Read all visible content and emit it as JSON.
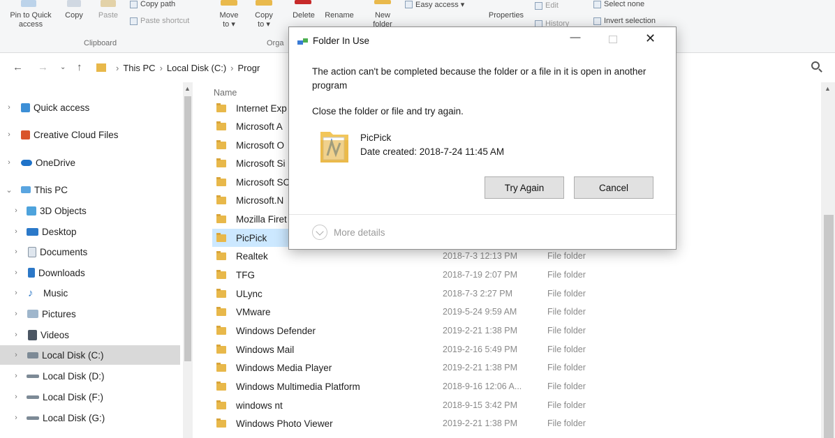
{
  "ribbon": {
    "pin_label": "Pin to Quick",
    "pin_label2": "access",
    "copy_label": "Copy",
    "paste_label": "Paste",
    "copy_path_label": "Copy path",
    "paste_shortcut_label": "Paste shortcut",
    "clipboard_group": "Clipboard",
    "move_to_label": "Move",
    "move_to_label2": "to ▾",
    "copy_to_label": "Copy",
    "copy_to_label2": "to ▾",
    "organize_group": "Orga",
    "delete_label": "Delete",
    "rename_label": "Rename",
    "new_folder_label": "New",
    "new_folder_label2": "folder",
    "easy_access_label": "Easy access ▾",
    "properties_label": "Properties",
    "edit_label": "Edit",
    "history_label": "History",
    "select_none_label": "Select none",
    "invert_selection_label": "Invert selection"
  },
  "address": {
    "crumbs": [
      "This PC",
      "Local Disk (C:)",
      "Progr"
    ]
  },
  "sidebar": {
    "items": [
      {
        "label": "Quick access"
      },
      {
        "label": "Creative Cloud Files"
      },
      {
        "label": "OneDrive"
      },
      {
        "label": "This PC"
      },
      {
        "label": "3D Objects"
      },
      {
        "label": "Desktop"
      },
      {
        "label": "Documents"
      },
      {
        "label": "Downloads"
      },
      {
        "label": "Music"
      },
      {
        "label": "Pictures"
      },
      {
        "label": "Videos"
      },
      {
        "label": "Local Disk (C:)"
      },
      {
        "label": "Local Disk (D:)"
      },
      {
        "label": "Local Disk (F:)"
      },
      {
        "label": "Local Disk (G:)"
      }
    ]
  },
  "file_list": {
    "col_name": "Name",
    "rows": [
      {
        "name": "Internet Exp",
        "date": "",
        "type": ""
      },
      {
        "name": "Microsoft A",
        "date": "",
        "type": ""
      },
      {
        "name": "Microsoft O",
        "date": "",
        "type": ""
      },
      {
        "name": "Microsoft Si",
        "date": "",
        "type": ""
      },
      {
        "name": "Microsoft SC",
        "date": "",
        "type": ""
      },
      {
        "name": "Microsoft.N",
        "date": "",
        "type": ""
      },
      {
        "name": "Mozilla Firet",
        "date": "",
        "type": ""
      },
      {
        "name": "PicPick",
        "date": "",
        "type": ""
      },
      {
        "name": "Realtek",
        "date": "2018-7-3 12:13 PM",
        "type": "File folder"
      },
      {
        "name": "TFG",
        "date": "2018-7-19 2:07 PM",
        "type": "File folder"
      },
      {
        "name": "ULync",
        "date": "2018-7-3 2:27 PM",
        "type": "File folder"
      },
      {
        "name": "VMware",
        "date": "2019-5-24 9:59 AM",
        "type": "File folder"
      },
      {
        "name": "Windows Defender",
        "date": "2019-2-21 1:38 PM",
        "type": "File folder"
      },
      {
        "name": "Windows Mail",
        "date": "2019-2-16 5:49 PM",
        "type": "File folder"
      },
      {
        "name": "Windows Media Player",
        "date": "2019-2-21 1:38 PM",
        "type": "File folder"
      },
      {
        "name": "Windows Multimedia Platform",
        "date": "2018-9-16 12:06 A...",
        "type": "File folder"
      },
      {
        "name": "windows nt",
        "date": "2018-9-15 3:42 PM",
        "type": "File folder"
      },
      {
        "name": "Windows Photo Viewer",
        "date": "2019-2-21 1:38 PM",
        "type": "File folder"
      }
    ]
  },
  "dialog": {
    "title": "Folder In Use",
    "message": "The action can't be completed because the folder or a file in it is open in another program",
    "instruction": "Close the folder or file and try again.",
    "file_name": "PicPick",
    "file_date": "Date created: 2018-7-24 11:45 AM",
    "try_again_label": "Try Again",
    "cancel_label": "Cancel",
    "more_details_label": "More details"
  }
}
